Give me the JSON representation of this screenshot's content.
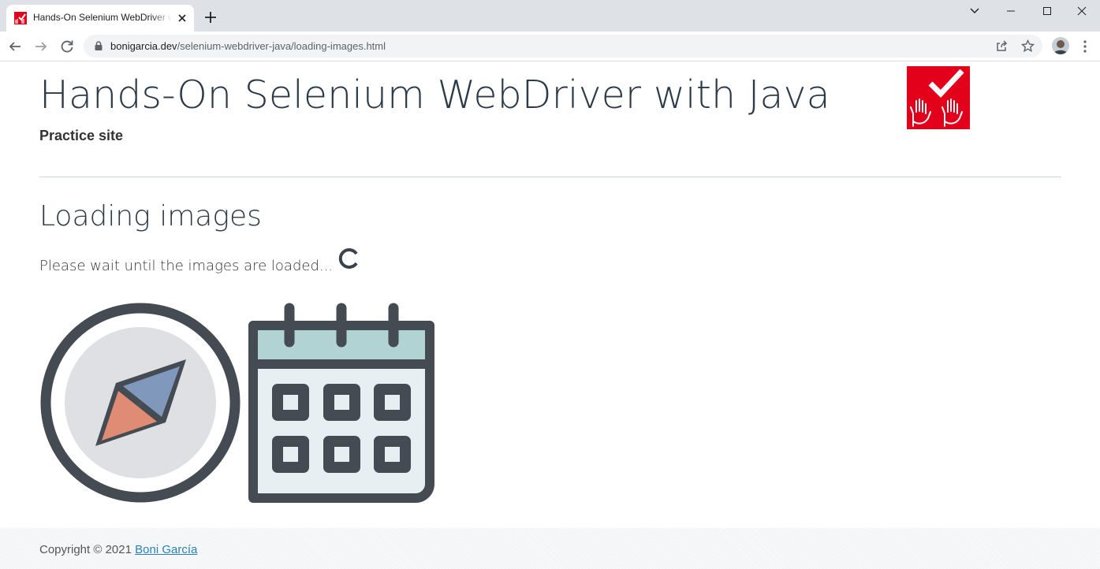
{
  "browser": {
    "tab": {
      "title": "Hands-On Selenium WebDriver with Java - Practice site",
      "favicon": "selenium-hands-logo"
    },
    "address_bar": {
      "domain": "bonigarcia.dev",
      "path": "/selenium-webdriver-java/loading-images.html"
    },
    "icons": [
      "back-arrow-icon",
      "forward-arrow-icon",
      "reload-icon",
      "lock-icon",
      "share-icon",
      "star-icon",
      "profile-avatar",
      "kebab-menu-icon",
      "minimize-icon",
      "maximize-icon",
      "close-icon",
      "chevron-down-icon",
      "new-tab-plus-icon"
    ]
  },
  "header": {
    "title": "Hands-On Selenium WebDriver with Java",
    "subtitle": "Practice site",
    "logo": "hands-checkmark-logo"
  },
  "main": {
    "heading": "Loading images",
    "wait_message": "Please wait until the images are loaded...",
    "spinner": "loading-spinner",
    "images": [
      {
        "name": "compass"
      },
      {
        "name": "calendar"
      }
    ]
  },
  "footer": {
    "copyright": "Copyright © 2021",
    "author": "Boni García"
  },
  "colors": {
    "logo_red": "#e3001b",
    "title_text": "#2b3a47",
    "icon_dark": "#454b53",
    "compass_face": "#dfe0e3",
    "compass_blue": "#8098bb",
    "compass_red": "#e08b73",
    "calendar_header": "#b2d3d3",
    "calendar_body": "#e8eff2",
    "link": "#2c7fb8"
  }
}
